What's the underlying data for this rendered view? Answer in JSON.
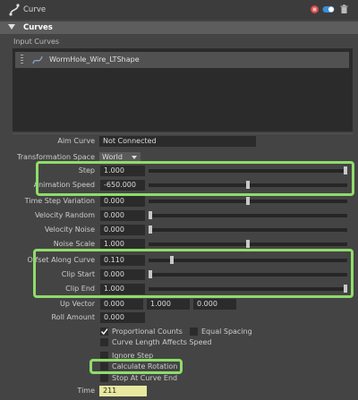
{
  "window": {
    "title": "Curve"
  },
  "section": {
    "label": "Curves"
  },
  "input_curves": {
    "label": "Input Curves",
    "items": [
      {
        "name": "WormHole_Wire_LTShape"
      }
    ]
  },
  "aim_curve": {
    "label": "Aim Curve",
    "value": "Not Connected"
  },
  "transformation_space": {
    "label": "Transformation Space",
    "value": "World"
  },
  "sliders": [
    {
      "label": "Step",
      "value": "1.000",
      "level": 1.0
    },
    {
      "label": "Animation Speed",
      "value": "-650.000",
      "level": 0.5
    },
    {
      "label": "Time Step Variation",
      "value": "0.000",
      "level": 0.5
    },
    {
      "label": "Velocity Random",
      "value": "0.000",
      "level": 0.0
    },
    {
      "label": "Velocity Noise",
      "value": "0.000",
      "level": 0.0
    },
    {
      "label": "Noise Scale",
      "value": "1.000",
      "level": 0.5
    },
    {
      "label": "Offset Along Curve",
      "value": "0.110",
      "level": 0.11
    },
    {
      "label": "Clip Start",
      "value": "0.000",
      "level": 0.0
    },
    {
      "label": "Clip End",
      "value": "1.000",
      "level": 1.0
    },
    {
      "label": "Roll Amount",
      "value": "0.000",
      "level": 0.0
    }
  ],
  "up_vector": {
    "label": "Up Vector",
    "x": "0.000",
    "y": "1.000",
    "z": "0.000"
  },
  "checkboxes": {
    "proportional_counts": {
      "label": "Proportional Counts",
      "checked": true
    },
    "equal_spacing": {
      "label": "Equal Spacing",
      "checked": false
    },
    "curve_length": {
      "label": "Curve Length Affects Speed",
      "checked": false
    },
    "ignore_step": {
      "label": "Ignore Step",
      "checked": false
    },
    "calculate_rotation": {
      "label": "Calculate Rotation",
      "checked": false
    },
    "stop_at_end": {
      "label": "Stop At Curve End",
      "checked": false
    }
  },
  "time": {
    "label": "Time",
    "value": "211"
  },
  "colors": {
    "highlight": "#8fdc6a",
    "panel": "#444444",
    "field": "#2b2b2b",
    "time_field": "#e8e8a0"
  }
}
